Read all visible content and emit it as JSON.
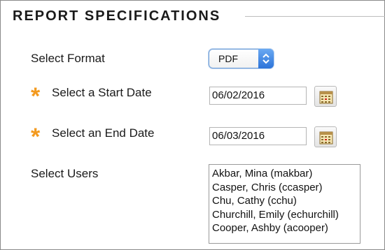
{
  "section": {
    "title": "REPORT SPECIFICATIONS"
  },
  "format": {
    "label": "Select Format",
    "selected": "PDF"
  },
  "start_date": {
    "required_marker": "*",
    "label": "Select a Start Date",
    "value": "06/02/2016",
    "icon": "calendar-icon"
  },
  "end_date": {
    "required_marker": "*",
    "label": "Select an End Date",
    "value": "06/03/2016",
    "icon": "calendar-icon"
  },
  "users": {
    "label": "Select Users",
    "options": [
      "Akbar, Mina (makbar)",
      "Casper, Chris (ccasper)",
      "Chu, Cathy (cchu)",
      "Churchill, Emily (echurchill)",
      "Cooper, Ashby (acooper)"
    ]
  },
  "colors": {
    "required_star": "#f39a1f",
    "select_accent": "#2c73d9"
  }
}
